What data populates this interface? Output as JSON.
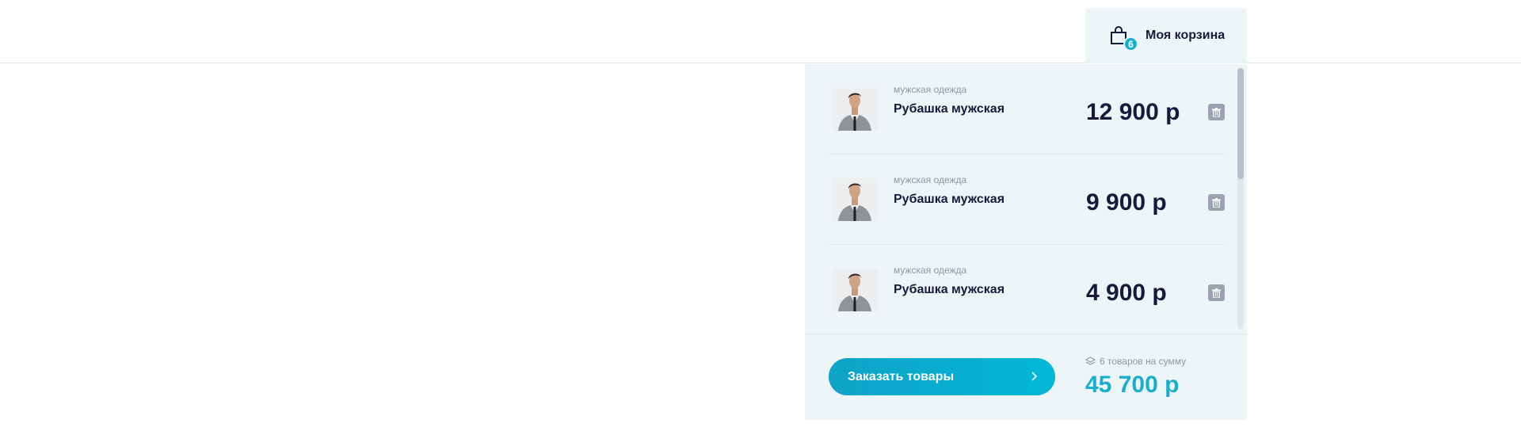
{
  "header": {
    "cart_label": "Моя корзина",
    "cart_count": "6"
  },
  "cart": {
    "items": [
      {
        "category": "мужская одежда",
        "name": "Рубашка мужская",
        "price": "12 900 р"
      },
      {
        "category": "мужская одежда",
        "name": "Рубашка мужская",
        "price": "9 900 р"
      },
      {
        "category": "мужская одежда",
        "name": "Рубашка мужская",
        "price": "4 900 р"
      }
    ],
    "order_button": "Заказать товары",
    "summary": "6 товаров на сумму",
    "total": "45 700 р"
  },
  "colors": {
    "accent": "#18afcf",
    "dark_text": "#131c3c",
    "panel_bg": "#eef5f9"
  }
}
